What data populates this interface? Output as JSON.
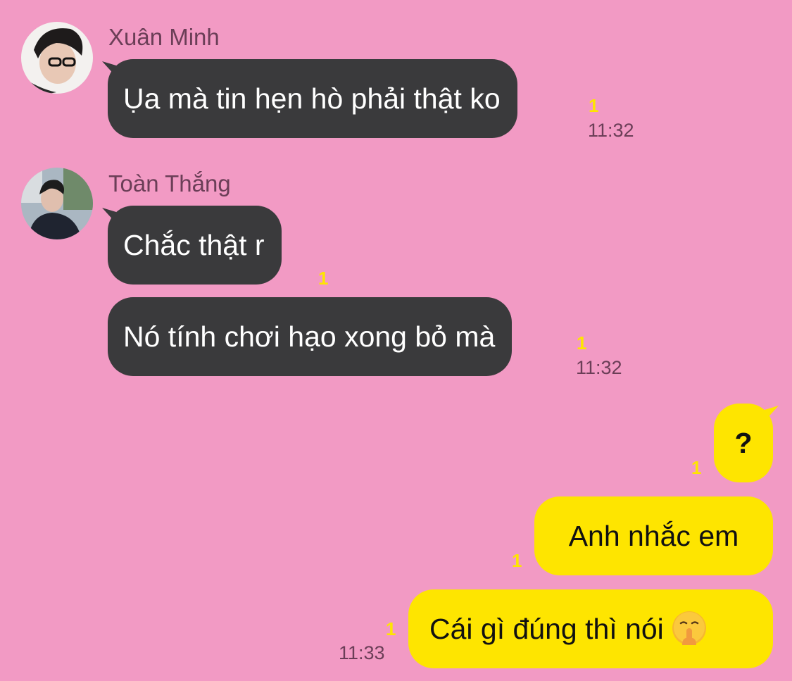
{
  "messages": [
    {
      "sender": "Xuân Minh",
      "text": "Ụa mà tin hẹn hò phải thật ko",
      "unread": "1",
      "time": "11:32"
    },
    {
      "sender": "Toàn Thắng",
      "text": "Chắc thật r",
      "unread": "1"
    },
    {
      "text": "Nó tính chơi hạo xong bỏ mà",
      "unread": "1",
      "time": "11:32"
    },
    {
      "text": "?",
      "unread": "1"
    },
    {
      "text": "Anh nhắc em",
      "unread": "1"
    },
    {
      "text": "Cái gì đúng thì nói",
      "emoji": "shushing-face",
      "unread": "1",
      "time": "11:33"
    }
  ],
  "colors": {
    "background": "#f29ac4",
    "incoming_bubble": "#3a3a3c",
    "outgoing_bubble": "#fee500",
    "unread_count": "#fee500",
    "meta_text": "#6b3e57"
  }
}
